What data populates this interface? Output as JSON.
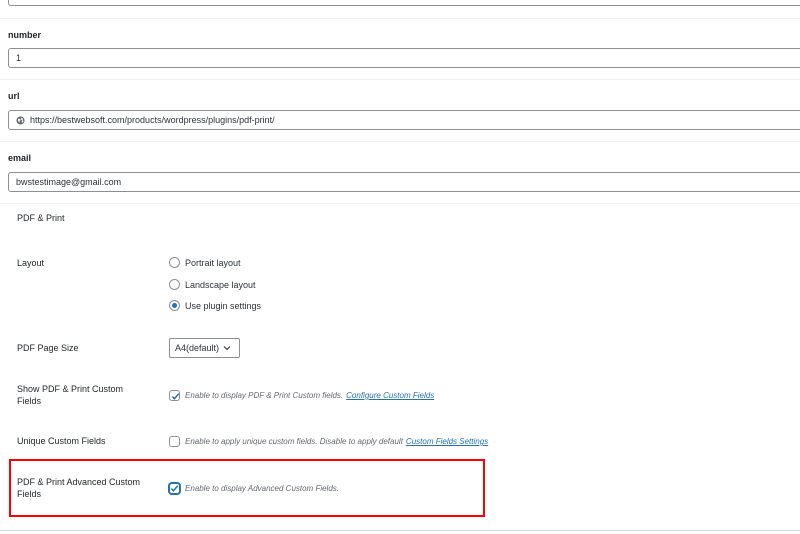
{
  "fields": {
    "number": {
      "label": "number",
      "value": "1"
    },
    "url": {
      "label": "url",
      "value": "https://bestwebsoft.com/products/wordpress/plugins/pdf-print/",
      "icon": "globe-icon"
    },
    "email": {
      "label": "email",
      "value": "bwstestimage@gmail.com"
    }
  },
  "pdf_print": {
    "section_title": "PDF & Print",
    "layout": {
      "label": "Layout",
      "options": [
        {
          "label": "Portrait layout",
          "checked": false
        },
        {
          "label": "Landscape layout",
          "checked": false
        },
        {
          "label": "Use plugin settings",
          "checked": true
        }
      ]
    },
    "page_size": {
      "label": "PDF Page Size",
      "selected": "A4(default)",
      "icon": "chevron-down-icon"
    },
    "show_custom_fields": {
      "label": "Show PDF & Print Custom Fields",
      "checked": true,
      "description": "Enable to display PDF & Print Custom fields.",
      "link": "Configure Custom Fields"
    },
    "unique_custom_fields": {
      "label": "Unique Custom Fields",
      "checked": false,
      "description": "Enable to apply unique custom fields. Disable to apply default",
      "link": "Custom Fields Settings"
    },
    "advanced_custom_fields": {
      "label": "PDF & Print Advanced Custom Fields",
      "checked": true,
      "description": "Enable to display Advanced Custom Fields."
    }
  },
  "colors": {
    "accent": "#2271b1",
    "highlight": "#ff0000",
    "border": "#8c8f94"
  }
}
